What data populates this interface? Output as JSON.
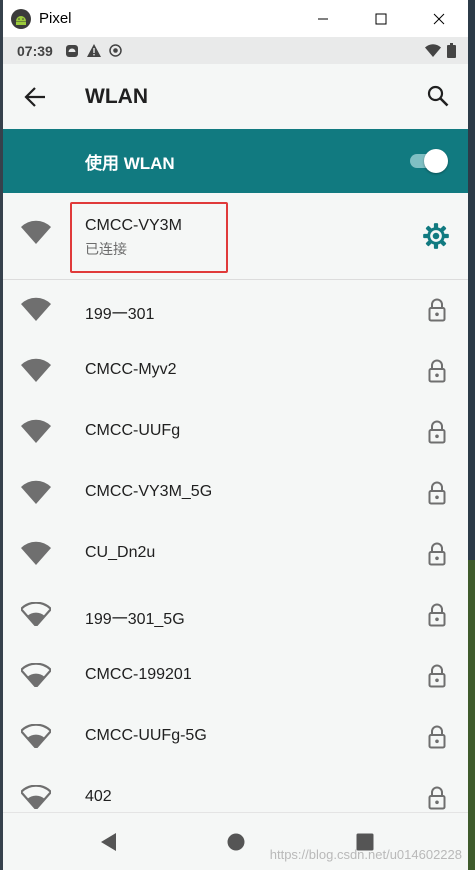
{
  "window": {
    "title": "Pixel"
  },
  "status_bar": {
    "time": "07:39"
  },
  "app_bar": {
    "title": "WLAN"
  },
  "master_switch": {
    "label": "使用 WLAN",
    "enabled": true
  },
  "connected_network": {
    "name": "CMCC-VY3M",
    "status": "已连接"
  },
  "networks": [
    {
      "name": "199一301",
      "signal": "full",
      "secured": true
    },
    {
      "name": "CMCC-Myv2",
      "signal": "full",
      "secured": true
    },
    {
      "name": "CMCC-UUFg",
      "signal": "full",
      "secured": true
    },
    {
      "name": "CMCC-VY3M_5G",
      "signal": "full",
      "secured": true
    },
    {
      "name": "CU_Dn2u",
      "signal": "full",
      "secured": true
    },
    {
      "name": "199一301_5G",
      "signal": "medium",
      "secured": true
    },
    {
      "name": "CMCC-199201",
      "signal": "medium",
      "secured": true
    },
    {
      "name": "CMCC-UUFg-5G",
      "signal": "medium",
      "secured": true
    },
    {
      "name": "402",
      "signal": "medium",
      "secured": true
    }
  ],
  "watermark": "https://blog.csdn.net/u014602228",
  "colors": {
    "accent": "#117a80",
    "highlight": "#e03a3a",
    "icon": "#6f6f6f"
  }
}
